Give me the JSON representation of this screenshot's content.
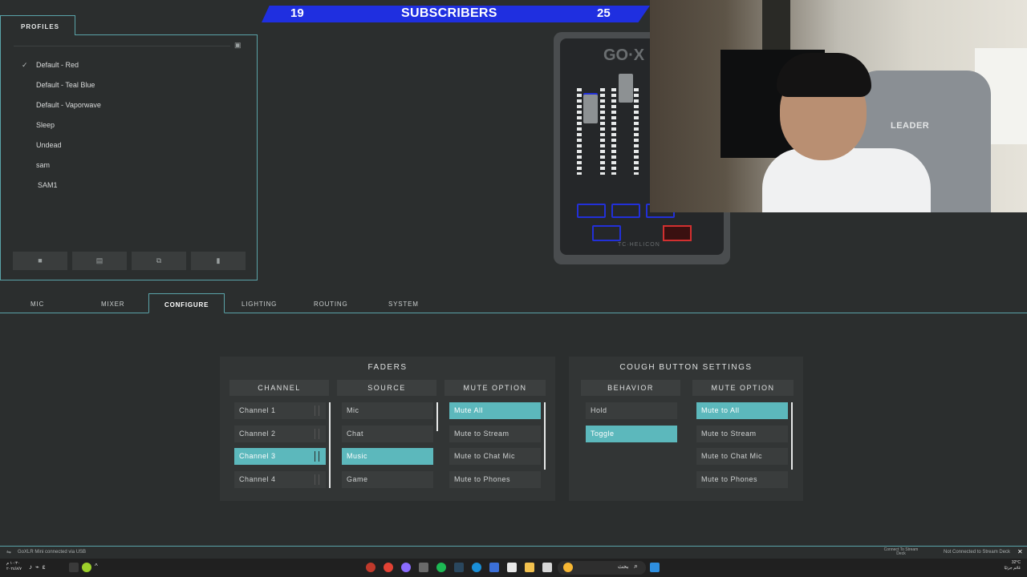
{
  "overlay": {
    "left_count": "19",
    "label": "SUBSCRIBERS",
    "right_count": "25",
    "color": "#1f2fe0"
  },
  "profiles": {
    "tab_label": "PROFILES",
    "items": [
      "Default - Red",
      "Default - Teal Blue",
      "Default - Vaporwave",
      "Sleep",
      "Undead",
      "sam",
      "SAM1"
    ],
    "selected": "Default - Red",
    "buttons": [
      "save-icon",
      "new-file-icon",
      "copy-icon",
      "delete-icon"
    ]
  },
  "device": {
    "logo": "GO·X",
    "brand": "TC·HELICON"
  },
  "webcam": {
    "chair_text": "LEADER"
  },
  "tabs": [
    "MIC",
    "MIXER",
    "CONFIGURE",
    "LIGHTING",
    "ROUTING",
    "SYSTEM"
  ],
  "active_tab": "CONFIGURE",
  "faders": {
    "title": "FADERS",
    "channel_header": "CHANNEL",
    "source_header": "SOURCE",
    "mute_header": "MUTE OPTION",
    "channels": [
      "Channel 1",
      "Channel 2",
      "Channel 3",
      "Channel 4"
    ],
    "selected_channel": "Channel 3",
    "sources": [
      "Mic",
      "Chat",
      "Music",
      "Game"
    ],
    "selected_source": "Music",
    "mute_options": [
      "Mute All",
      "Mute to Stream",
      "Mute to Chat Mic",
      "Mute to Phones"
    ],
    "selected_mute": "Mute All"
  },
  "cough": {
    "title": "COUGH BUTTON SETTINGS",
    "behavior_header": "BEHAVIOR",
    "mute_header": "MUTE OPTION",
    "behaviors": [
      "Hold",
      "Toggle"
    ],
    "selected_behavior": "Toggle",
    "mute_options": [
      "Mute to All",
      "Mute to Stream",
      "Mute to Chat Mic",
      "Mute to Phones"
    ],
    "selected_mute": "Mute to All"
  },
  "status": {
    "left": "GoXLR Mini connected via USB",
    "middle": "Connect To Stream Deck",
    "right": "Not Connected to Stream Deck"
  },
  "taskbar": {
    "search_text": "بحث",
    "weather_temp": "32°C",
    "weather_text": "غائم جزئيًا",
    "clock_time": "١٠:٣٠ م",
    "clock_date": "٢٠٢٤/٨/٧"
  },
  "accent": "#5cb8bc"
}
